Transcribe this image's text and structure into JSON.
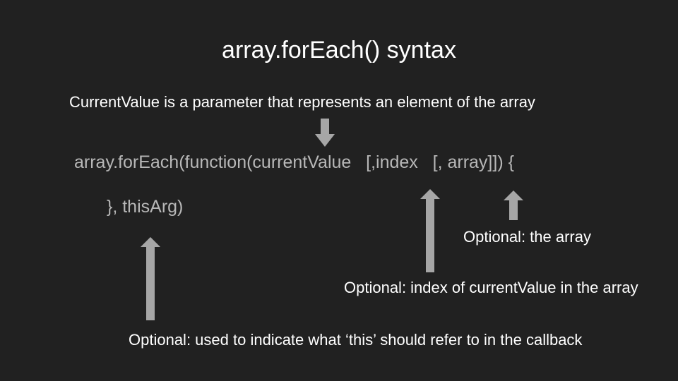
{
  "slide": {
    "title": "array.forEach() syntax",
    "current_value_note": "CurrentValue is a parameter that represents an element of the array",
    "code_line1": "array.forEach(function(currentValue   [,index   [, array]]) {",
    "code_line2": "}, thisArg)",
    "array_note": "Optional: the array",
    "index_note": "Optional: index of currentValue in the array",
    "this_arg_note": "Optional: used to indicate what ‘this’ should refer to in the callback"
  },
  "colors": {
    "background": "#212121",
    "title_text": "#ffffff",
    "code_text": "#b7b7b7",
    "arrow": "#a6a6a6"
  },
  "icons": {
    "down_arrow": "arrow-down-icon",
    "up_arrows": "arrow-up-icon"
  }
}
